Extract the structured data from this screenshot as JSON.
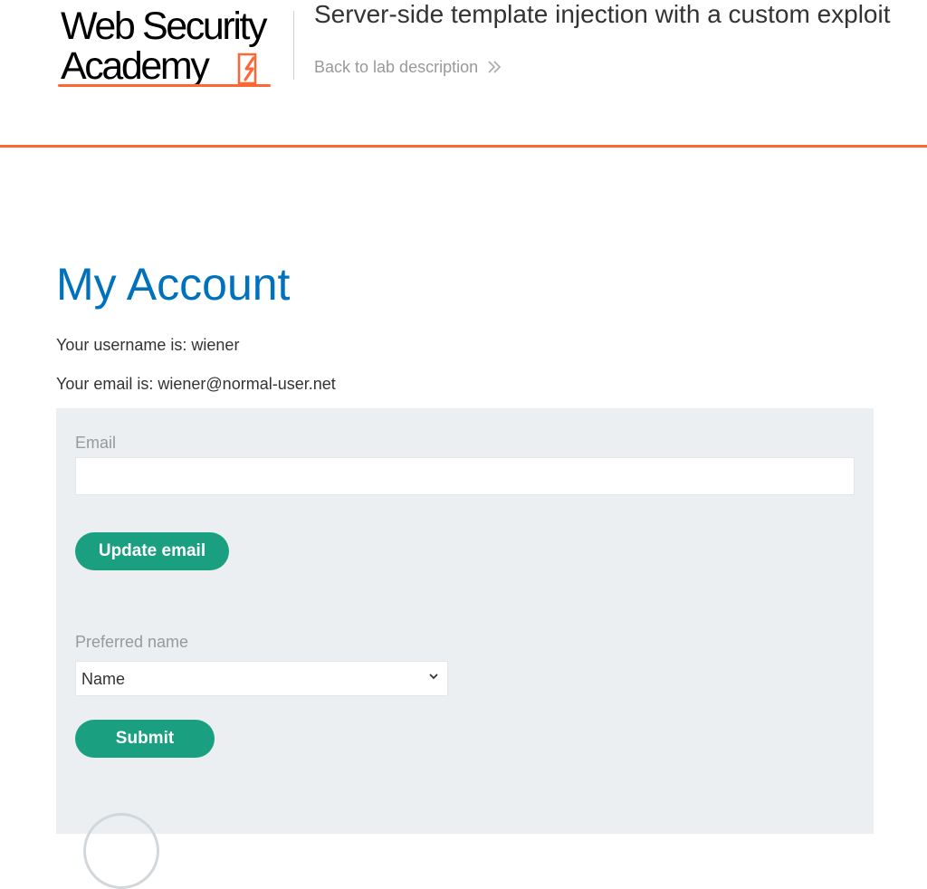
{
  "header": {
    "logo": {
      "line1": "Web Security",
      "line2": "Academy",
      "accent": "#ff6633"
    },
    "lab_title": "Server-side template injection with a custom exploit",
    "back_link": {
      "label": "Back to lab description",
      "icon": "double-chevron-right-icon"
    },
    "divider_color": "#ff6633"
  },
  "main": {
    "title": "My Account",
    "title_color": "#0071bc",
    "username_text": "Your username is: wiener",
    "email_text": "Your email is: wiener@normal-user.net"
  },
  "form": {
    "email_label": "Email",
    "email_value": "",
    "update_button": "Update email",
    "preferred_name_label": "Preferred name",
    "preferred_name_selected": "Name",
    "submit_button": "Submit",
    "button_color": "#1a9f80",
    "panel_color": "#ebeff2"
  }
}
